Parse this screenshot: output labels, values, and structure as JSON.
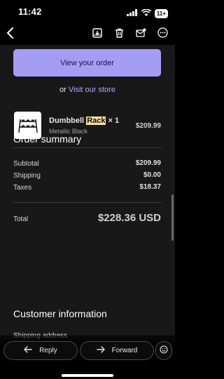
{
  "status_bar": {
    "time": "11:42",
    "badge": "11+"
  },
  "toolbar": {
    "back": "chevron-left-icon",
    "archive": "archive-icon",
    "delete": "trash-icon",
    "mark_unread": "mail-badge-icon",
    "more": "more-icon"
  },
  "email": {
    "view_order_button": "View your order",
    "or_text": "or",
    "visit_store_link": "Visit our store",
    "order_summary_title": "Order summary",
    "product": {
      "name_before": "Dumbbell",
      "name_highlight": "Rack",
      "quantity": "× 1",
      "variant": "Metallic Black",
      "price": "$209.99"
    },
    "subtotal_label": "Subtotal",
    "subtotal_value": "$209.99",
    "shipping_label": "Shipping",
    "shipping_value": "$0.00",
    "taxes_label": "Taxes",
    "taxes_value": "$18.37",
    "total_label": "Total",
    "total_value": "$228.36 USD",
    "customer_info_title": "Customer information",
    "shipping_address_label": "Shipping address"
  },
  "actions": {
    "reply": "Reply",
    "forward": "Forward"
  },
  "colors": {
    "accent": "#a59cf4",
    "link": "#b1a8ff",
    "highlight": "#f6dfa0",
    "background": "#181818"
  }
}
